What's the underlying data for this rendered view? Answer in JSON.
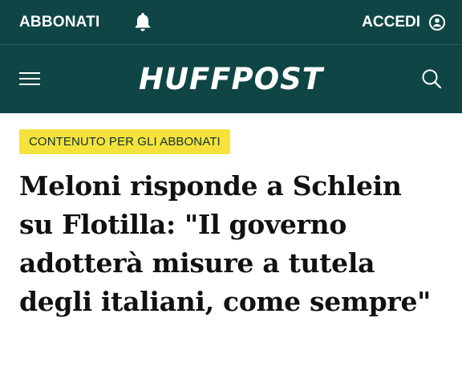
{
  "header": {
    "subscribe_label": "ABBONATI",
    "login_label": "ACCEDI",
    "brand": "HUFFPOST",
    "icons": {
      "bell": "bell-icon",
      "user": "user-circle-icon",
      "menu": "hamburger-menu-icon",
      "search": "search-icon"
    },
    "colors": {
      "bar": "#0f4545",
      "text": "#ffffff"
    }
  },
  "article": {
    "badge": "CONTENUTO PER GLI ABBONATI",
    "title": "Meloni risponde a Schlein su Flotilla: \"Il governo adotterà misure a tutela degli italiani, come sempre\"",
    "colors": {
      "badge_bg": "#f5e33b"
    }
  }
}
